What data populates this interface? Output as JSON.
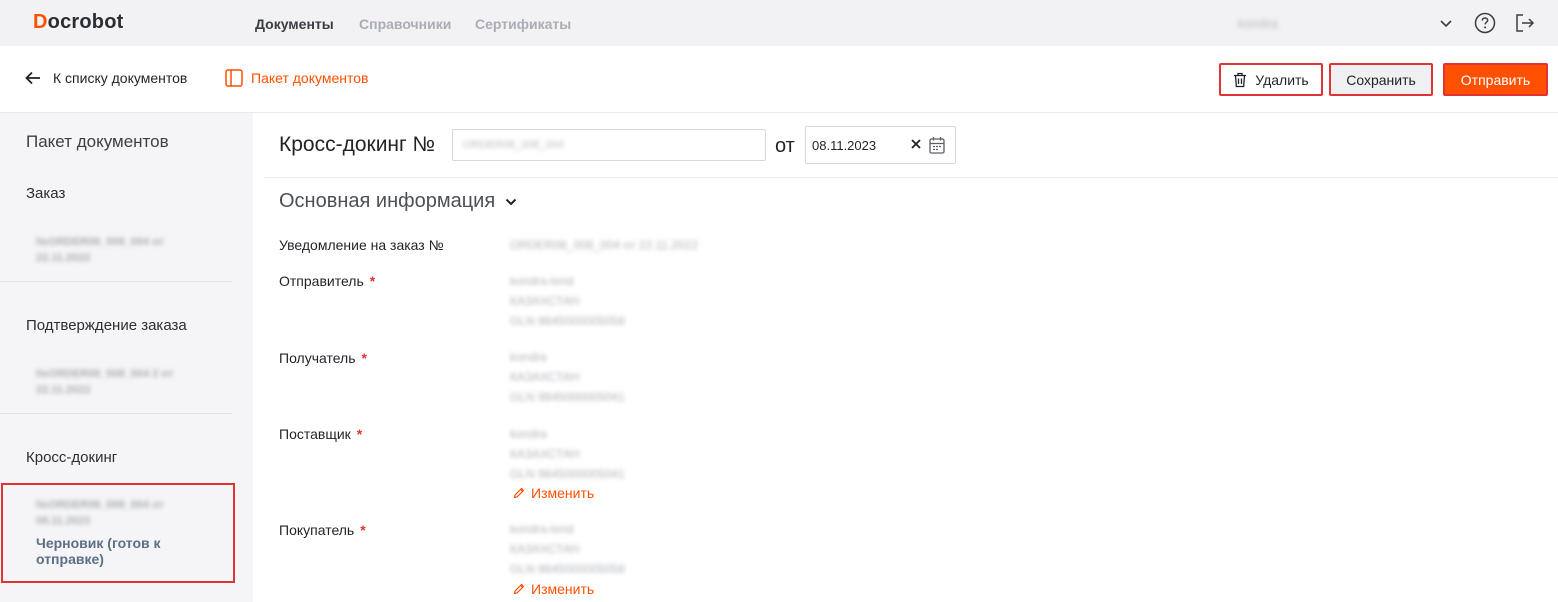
{
  "app": {
    "logo_initial": "D",
    "logo_rest": "ocrobot"
  },
  "nav": {
    "items": [
      {
        "label": "Документы",
        "active": true
      },
      {
        "label": "Справочники",
        "active": false
      },
      {
        "label": "Сертификаты",
        "active": false
      }
    ],
    "user": "kondra"
  },
  "toolbar": {
    "back_label": "К списку документов",
    "packet_label": "Пакет документов",
    "delete_label": "Удалить",
    "save_label": "Сохранить",
    "send_label": "Отправить"
  },
  "sidebar": {
    "title": "Пакет документов",
    "groups": [
      {
        "label": "Заказ",
        "doc": "№ORDER08_008_004 от 22.11.2022"
      },
      {
        "label": "Подтверждение заказа",
        "doc": "№ORDER08_008_004 2 от 22.11.2022"
      },
      {
        "label": "Кросс-докинг",
        "doc": "№ORDER08_008_004 от 08.11.2023",
        "status": "Черновик (готов к отправке)"
      }
    ]
  },
  "document": {
    "title": "Кросс-докинг №",
    "number_value": "ORDER08_008_004",
    "date_prefix": "от",
    "date_value": "08.11.2023"
  },
  "section": {
    "title": "Основная информация",
    "fields": [
      {
        "label": "Уведомление на заказ №",
        "required": false,
        "lines": [
          "ORDER08_008_004 от 22.11.2022"
        ]
      },
      {
        "label": "Отправитель",
        "required": true,
        "lines": [
          "kondra-lend",
          "КАЗАХСТАН",
          "GLN 9845000005058"
        ]
      },
      {
        "label": "Получатель",
        "required": true,
        "lines": [
          "kondra",
          "КАЗАХСТАН",
          "GLN 9845000005041"
        ]
      },
      {
        "label": "Поставщик",
        "required": true,
        "lines": [
          "kondra",
          "КАЗАХСТАН",
          "GLN 9845000005041"
        ],
        "edit": "Изменить"
      },
      {
        "label": "Покупатель",
        "required": true,
        "lines": [
          "kondra-lend",
          "КАЗАХСТАН",
          "GLN 9845000005058"
        ],
        "edit": "Изменить"
      }
    ]
  },
  "colors": {
    "accent": "#fe5000",
    "highlight_border": "#e03434",
    "status": "#5c6f85"
  }
}
